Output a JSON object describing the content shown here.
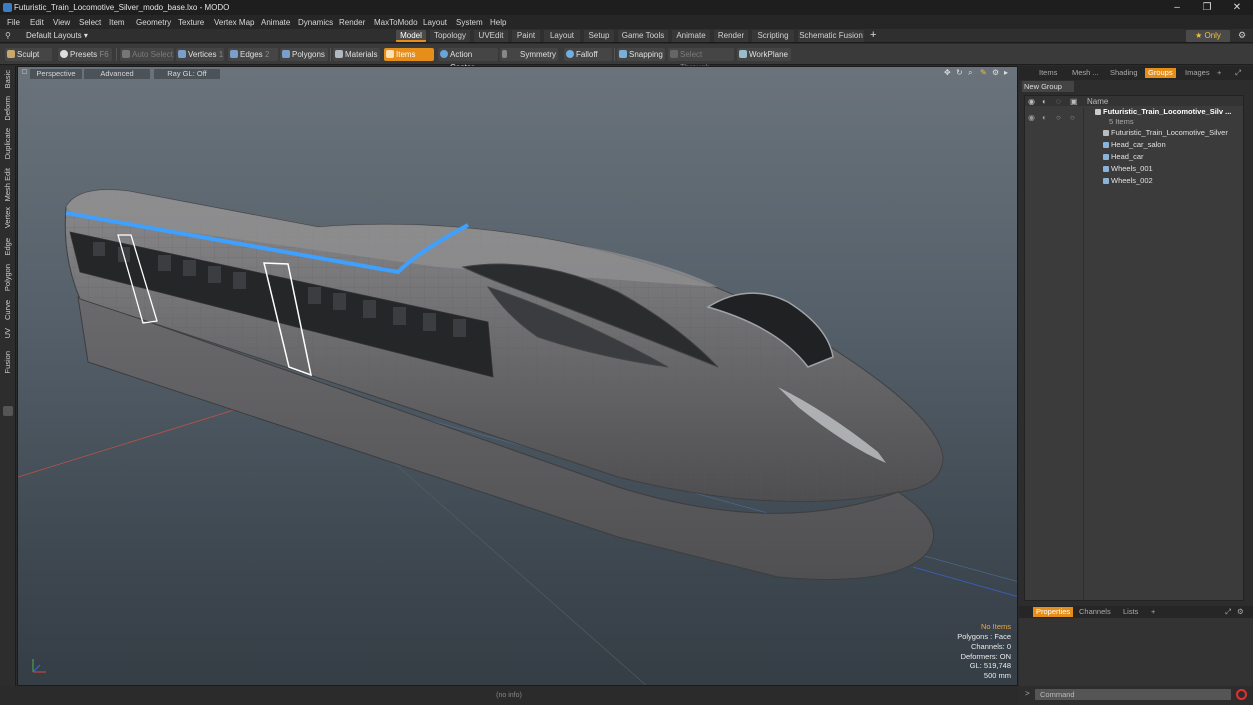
{
  "window": {
    "title": "Futuristic_Train_Locomotive_Silver_modo_base.lxo - MODO",
    "minimize": "–",
    "maximize": "❐",
    "close": "✕"
  },
  "menu": [
    "File",
    "Edit",
    "View",
    "Select",
    "Item",
    "Geometry",
    "Texture",
    "Vertex Map",
    "Animate",
    "Dynamics",
    "Render",
    "MaxToModo",
    "Layout",
    "System",
    "Help"
  ],
  "layoutbar": {
    "layout_select": "Default Layouts ▾",
    "tabs": [
      "Model",
      "Topology",
      "UVEdit",
      "Paint",
      "Layout",
      "Setup",
      "Game Tools",
      "Animate",
      "Render",
      "Scripting",
      "Schematic Fusion"
    ],
    "add": "+",
    "only": "★  Only",
    "settings_icon": "gear-icon"
  },
  "toolbar": {
    "sculpt": "Sculpt",
    "presets": "Presets",
    "presets_key": "F6",
    "auto_select": "Auto Select",
    "vertices": "Vertices",
    "vertices_key": "1",
    "edges": "Edges",
    "edges_key": "2",
    "polygons": "Polygons",
    "materials": "Materials",
    "items": "Items",
    "action_center": "Action Center",
    "symmetry": "Symmetry",
    "falloff": "Falloff",
    "snapping": "Snapping",
    "select_through": "Select Through",
    "workplane": "WorkPlane"
  },
  "left_tabs": [
    "Basic",
    "Deform",
    "Duplicate",
    "Mesh Edit",
    "Vertex",
    "Edge",
    "Polygon",
    "Curve",
    "UV",
    "Fusion"
  ],
  "viewport": {
    "perspective": "Perspective",
    "advanced": "Advanced",
    "ray_gl": "Ray GL: Off",
    "info": {
      "items": "No Items",
      "polygons": "Polygons : Face",
      "channels": "Channels: 0",
      "deformers": "Deformers: ON",
      "gl": "GL: 519,748",
      "scale": "500 mm"
    }
  },
  "status": "(no info)",
  "right_panel": {
    "tabs": [
      "Items",
      "Mesh ...",
      "Shading",
      "Groups",
      "Images"
    ],
    "active_tab": "Groups",
    "new_group": "New Group",
    "name_header": "Name",
    "group_name": "Futuristic_Train_Locomotive_Silv ...",
    "group_count": "5 Items",
    "items": [
      "Futuristic_Train_Locomotive_Silver",
      "Head_car_salon",
      "Head_car",
      "Wheels_001",
      "Wheels_002"
    ],
    "bottom_tabs": [
      "Properties",
      "Channels",
      "Lists"
    ],
    "command_placeholder": "Command"
  },
  "colors": {
    "accent": "#e58e1a",
    "stripe": "#3ea0ff",
    "body": "#6d6d6f"
  }
}
